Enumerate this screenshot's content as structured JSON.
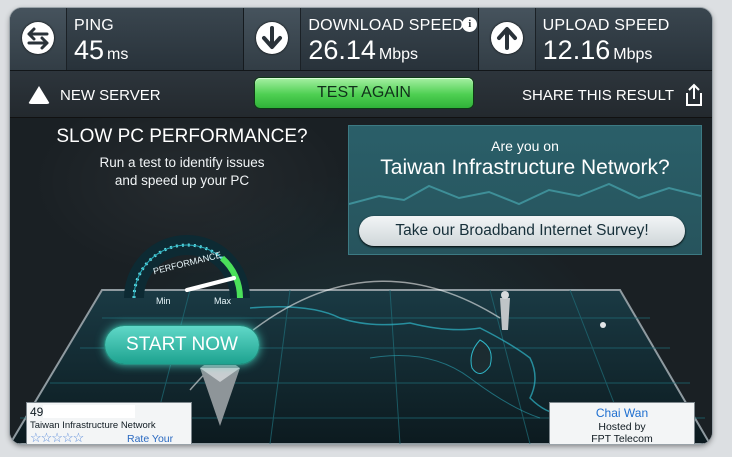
{
  "metrics": {
    "ping": {
      "label": "PING",
      "value": "45",
      "unit": "ms",
      "icon": "bidirectional-arrows-icon"
    },
    "download": {
      "label": "DOWNLOAD SPEED",
      "value": "26.14",
      "unit": "Mbps",
      "icon": "download-arrow-icon",
      "info": "i"
    },
    "upload": {
      "label": "UPLOAD SPEED",
      "value": "12.16",
      "unit": "Mbps",
      "icon": "upload-arrow-icon"
    }
  },
  "actions": {
    "new_server": "NEW SERVER",
    "test_again": "TEST AGAIN",
    "share": "SHARE THIS RESULT"
  },
  "promo": {
    "title": "SLOW PC PERFORMANCE?",
    "desc_line1": "Run a test to identify issues",
    "desc_line2": "and speed up your PC",
    "gauge_label": "PERFORMANCE",
    "gauge_min": "Min",
    "gauge_max": "Max",
    "start": "START NOW"
  },
  "survey": {
    "question": "Are you on",
    "network": "Taiwan Infrastructure Network?",
    "button": "Take our Broadband Internet Survey!"
  },
  "client": {
    "ip_prefix": "49",
    "isp": "Taiwan Infrastructure Network",
    "stars": "☆☆☆☆☆",
    "rate": "Rate Your ISP"
  },
  "host": {
    "city": "Chai Wan",
    "hosted_by": "Hosted by",
    "name": "FPT Telecom"
  },
  "colors": {
    "accent_green": "#4ecf52",
    "teal": "#1da28f",
    "map_line": "#2fb7c9"
  }
}
